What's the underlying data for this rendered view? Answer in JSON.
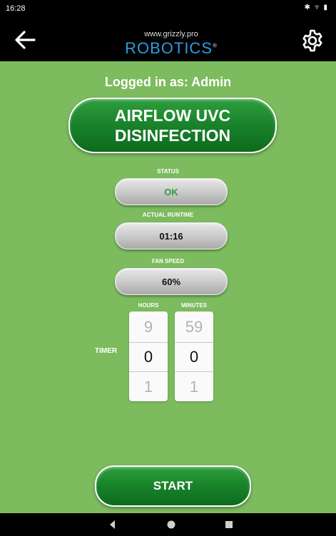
{
  "status_bar": {
    "time": "16:28",
    "icons": "✱ ▿ ▮"
  },
  "app_bar": {
    "logo_url_text": "www.grizzly.pro",
    "logo_brand_text": "ROBOTICS",
    "logo_mark": "®",
    "back_icon": "arrow-left-icon",
    "settings_icon": "gear-icon"
  },
  "main": {
    "logged_in_text": "Logged in as: Admin",
    "title_line1": "AIRFLOW UVC",
    "title_line2": "DISINFECTION",
    "status": {
      "label": "STATUS",
      "value": "OK",
      "value_color": "#2e9c3c"
    },
    "runtime": {
      "label": "ACTUAL RUNTIME",
      "value": "01:16"
    },
    "fan_speed": {
      "label": "FAN SPEED",
      "value": "60%"
    },
    "timer": {
      "label": "TIMER",
      "hours": {
        "label": "HOURS",
        "prev": "9",
        "current": "0",
        "next": "1"
      },
      "minutes": {
        "label": "MINUTES",
        "prev": "59",
        "current": "0",
        "next": "1"
      }
    },
    "start_label": "START"
  },
  "nav_bar": {
    "back": "nav-back-icon",
    "home": "nav-home-icon",
    "recents": "nav-recents-icon"
  },
  "colors": {
    "background": "#7cbb5e",
    "accent_green": "#18822a",
    "brand_blue": "#2f9be0"
  }
}
